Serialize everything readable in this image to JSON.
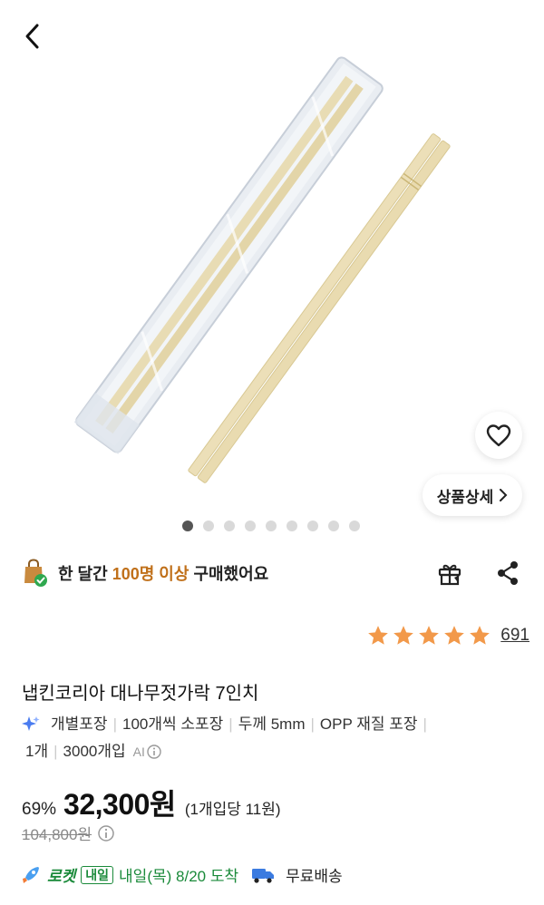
{
  "product": {
    "title": "냅킨코리아 대나무젓가락 7인치",
    "features": [
      "개별포장",
      "100개씩 소포장",
      "두께 5mm",
      "OPP 재질 포장",
      "1개",
      "3000개입"
    ],
    "ai_label": "AI",
    "detail_button": "상품상세",
    "image_count": 9,
    "active_image_index": 0
  },
  "social_proof": {
    "prefix": "한 달간",
    "highlight": "100명 이상",
    "suffix": "구매했어요"
  },
  "rating": {
    "stars": 5,
    "review_count": "691"
  },
  "pricing": {
    "discount": "69%",
    "price": "32,300원",
    "unit_price": "(1개입당 11원)",
    "original_price": "104,800원"
  },
  "delivery": {
    "rocket": "로켓",
    "badge": "내일",
    "arrival": "내일(목) 8/20 도착",
    "shipping": "무료배송"
  },
  "colors": {
    "accent_orange": "#c0701a",
    "rocket_green": "#1a8a3a",
    "star": "#f2994a"
  }
}
